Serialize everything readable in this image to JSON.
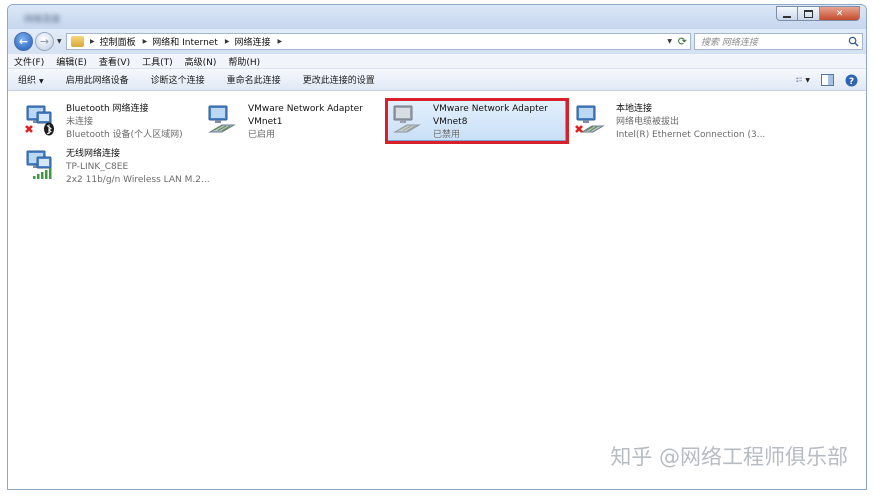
{
  "window": {
    "title": "网络连接"
  },
  "address": {
    "crumbs": [
      "控制面板",
      "网络和 Internet",
      "网络连接"
    ],
    "search_placeholder": "搜索 网络连接"
  },
  "menu": [
    "文件(F)",
    "编辑(E)",
    "查看(V)",
    "工具(T)",
    "高级(N)",
    "帮助(H)"
  ],
  "toolbar": {
    "organize": "组织",
    "items": [
      "启用此网络设备",
      "诊断这个连接",
      "重命名此连接",
      "更改此连接的设置"
    ]
  },
  "connections": [
    {
      "name": "Bluetooth 网络连接",
      "line2": "未连接",
      "line3": "Bluetooth 设备(个人区域网)",
      "icon": "bluetooth-network-icon",
      "status": "disconnected"
    },
    {
      "name": "VMware Network Adapter",
      "line2": "VMnet1",
      "line3": "已启用",
      "icon": "network-adapter-icon",
      "status": "enabled"
    },
    {
      "name": "VMware Network Adapter",
      "line2": "VMnet8",
      "line3": "已禁用",
      "icon": "network-adapter-disabled-icon",
      "status": "disabled",
      "selected": true
    },
    {
      "name": "本地连接",
      "line2": "网络电缆被拔出",
      "line3": "Intel(R) Ethernet Connection (3...",
      "icon": "local-network-icon",
      "status": "unplugged"
    },
    {
      "name": "无线网络连接",
      "line2": "TP-LINK_C8EE",
      "line3": "2x2 11b/g/n Wireless LAN M.2...",
      "icon": "wireless-network-icon",
      "status": "connected"
    }
  ],
  "watermark": "知乎 @网络工程师俱乐部",
  "colors": {
    "highlight": "#d8202b",
    "selection": "#c9e0f7",
    "error_x": "#e02020"
  }
}
